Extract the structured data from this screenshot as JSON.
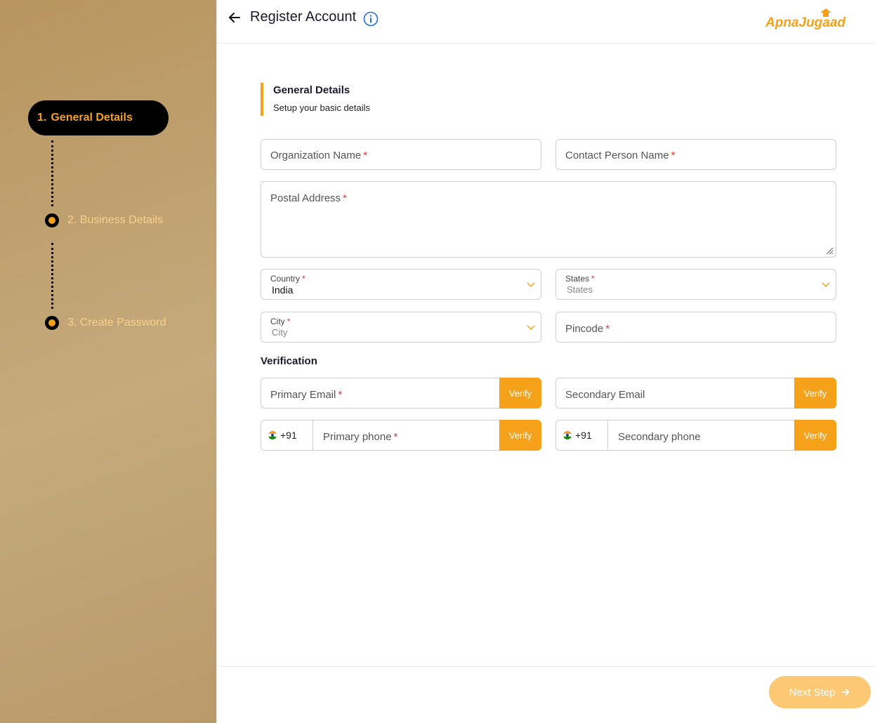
{
  "sidebar": {
    "steps": [
      {
        "num": "1.",
        "label": "General Details"
      },
      {
        "label": "2. Business Details"
      },
      {
        "label": "3. Create Password"
      }
    ]
  },
  "header": {
    "title": "Register Account",
    "logo_text": "ApnaJugaad"
  },
  "section": {
    "heading": "General Details",
    "subheading": "Setup your basic details"
  },
  "form": {
    "organization_name": "Organization Name",
    "contact_person_name": "Contact Person Name",
    "postal_address": "Postal Address",
    "country": {
      "label": "Country",
      "value": "India"
    },
    "states": {
      "label": "States",
      "value": "States"
    },
    "city": {
      "label": "City",
      "value": "City"
    },
    "pincode": "Pincode",
    "required_mark": "*"
  },
  "verification": {
    "title": "Verification",
    "primary_email": "Primary Email",
    "secondary_email": "Secondary Email",
    "primary_phone": "Primary phone",
    "secondary_phone": "Secondary phone",
    "country_code": "+91",
    "verify_label": "Verify"
  },
  "footer": {
    "next_label": "Next Step"
  },
  "colors": {
    "accent": "#f5a21a",
    "next_button": "#fcc874",
    "sidebar": "#c0a272"
  }
}
